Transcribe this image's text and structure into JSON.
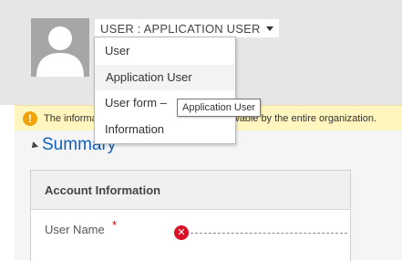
{
  "header": {
    "form_selector_label": "USER : APPLICATION USER",
    "avatar_icon": "user-silhouette-icon"
  },
  "form_menu": {
    "items": [
      {
        "label": "User"
      },
      {
        "label": "Application User"
      },
      {
        "label": "User form –"
      },
      {
        "label": "Information"
      }
    ],
    "tooltip": "Application User"
  },
  "notification": {
    "icon": "warning-icon",
    "text": "The information provided in this form is viewable by the entire organization."
  },
  "summary": {
    "title": "Summary",
    "panel_title": "Account Information",
    "fields": [
      {
        "label": "User Name",
        "required_marker": "*",
        "error_icon": "error-x-icon",
        "value": ""
      }
    ]
  },
  "colors": {
    "header_bg": "#e6e6e6",
    "notification_bg": "#fff6bf",
    "warning_icon": "#f0a30a",
    "summary_title": "#1160b7",
    "error_icon": "#d80f25"
  }
}
